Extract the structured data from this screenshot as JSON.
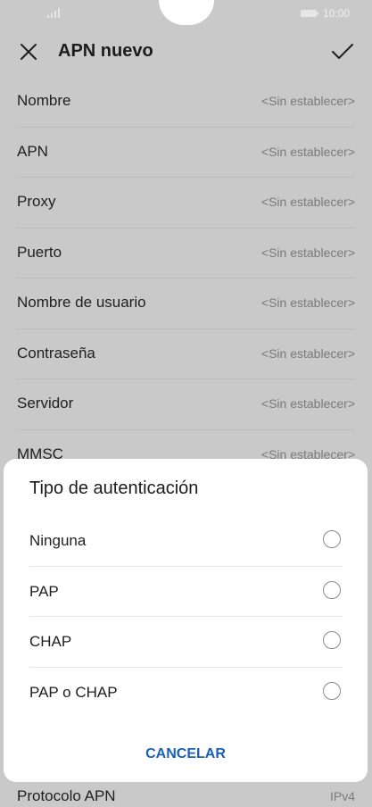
{
  "status_bar": {
    "time": "10:00",
    "signal_icon": "signal-bars-icon",
    "battery_icon": "battery-icon"
  },
  "header": {
    "title": "APN nuevo",
    "close_icon": "close-icon",
    "confirm_icon": "check-icon"
  },
  "settings": [
    {
      "label": "Nombre",
      "value": "<Sin establecer>"
    },
    {
      "label": "APN",
      "value": "<Sin establecer>"
    },
    {
      "label": "Proxy",
      "value": "<Sin establecer>"
    },
    {
      "label": "Puerto",
      "value": "<Sin establecer>"
    },
    {
      "label": "Nombre de usuario",
      "value": "<Sin establecer>"
    },
    {
      "label": "Contraseña",
      "value": "<Sin establecer>"
    },
    {
      "label": "Servidor",
      "value": "<Sin establecer>"
    },
    {
      "label": "MMSC",
      "value": "<Sin establecer>"
    }
  ],
  "bottom_setting": {
    "label": "Protocolo APN",
    "value": "IPv4"
  },
  "dialog": {
    "title": "Tipo de autenticación",
    "options": [
      {
        "label": "Ninguna",
        "selected": false
      },
      {
        "label": "PAP",
        "selected": false
      },
      {
        "label": "CHAP",
        "selected": false
      },
      {
        "label": "PAP o CHAP",
        "selected": false
      }
    ],
    "cancel_label": "CANCELAR"
  },
  "colors": {
    "overlay": "#c9c9c9",
    "dialog_bg": "#ffffff",
    "accent": "#1a5fb4"
  }
}
